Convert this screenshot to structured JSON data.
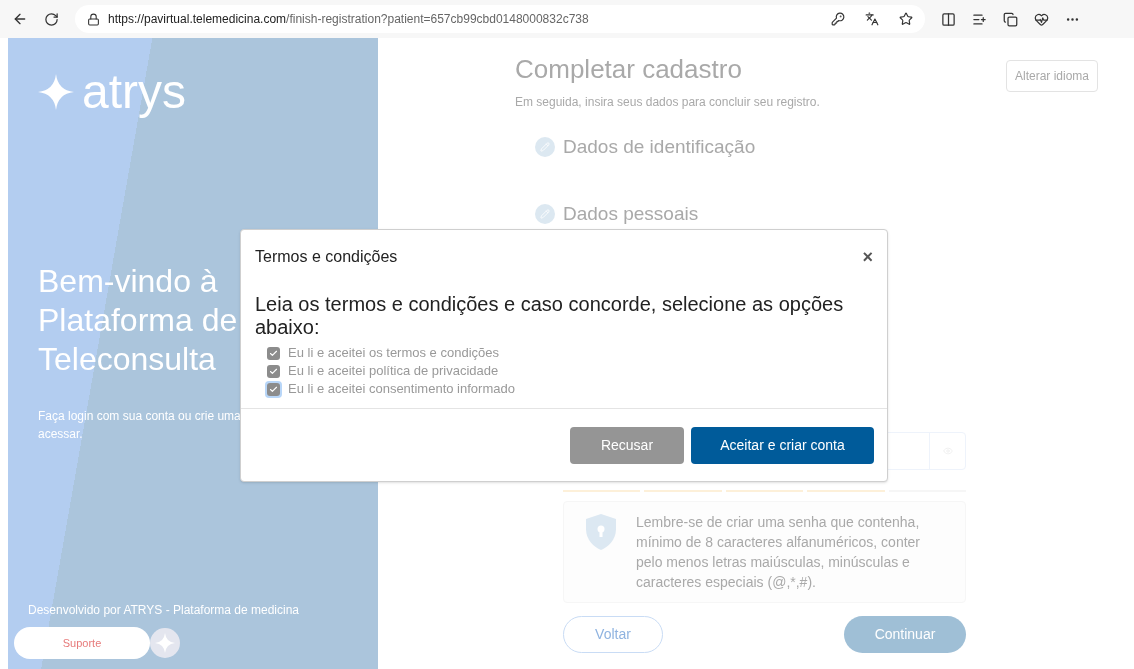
{
  "browser": {
    "url_host": "https://pavirtual.telemedicina.com",
    "url_path": "/finish-registration?patient=657cb99cbd0148000832c738"
  },
  "left_panel": {
    "logo": "atrys",
    "heading_lines": [
      "Bem-vindo à",
      "Plataforma de",
      "Teleconsulta"
    ],
    "subtitle_lines": [
      "Faça login com sua conta ou crie uma",
      "acessar."
    ],
    "footer": "Desenvolvido por ATRYS - Plataforma de medicina",
    "support_button": "Suporte"
  },
  "form": {
    "title": "Completar cadastro",
    "subtitle": "Em seguida, insira seus dados para concluir seu registro.",
    "language_button": "Alterar idioma",
    "steps": [
      {
        "label": "Dados de identificação"
      },
      {
        "label": "Dados pessoais"
      }
    ],
    "password_strength": {
      "level": 0.8
    },
    "password_tip": "Lembre-se de criar uma senha que contenha, mínimo de 8 caracteres alfanuméricos, conter pelo menos letras maiúsculas, minúsculas e caracteres especiais (@,*,#).",
    "back_button": "Voltar",
    "continue_button": "Continuar"
  },
  "modal": {
    "title": "Termos e condições",
    "close": "×",
    "instruction": "Leia os termos e condições e caso concorde, selecione as opções abaixo:",
    "checkboxes": [
      {
        "label": "Eu li e aceitei os termos e condições",
        "checked": true,
        "focused": false
      },
      {
        "label": "Eu li e aceitei política de privacidade",
        "checked": true,
        "focused": false
      },
      {
        "label": "Eu li e aceitei consentimento informado",
        "checked": true,
        "focused": true
      }
    ],
    "decline_button": "Recusar",
    "accept_button": "Aceitar e criar conta"
  }
}
